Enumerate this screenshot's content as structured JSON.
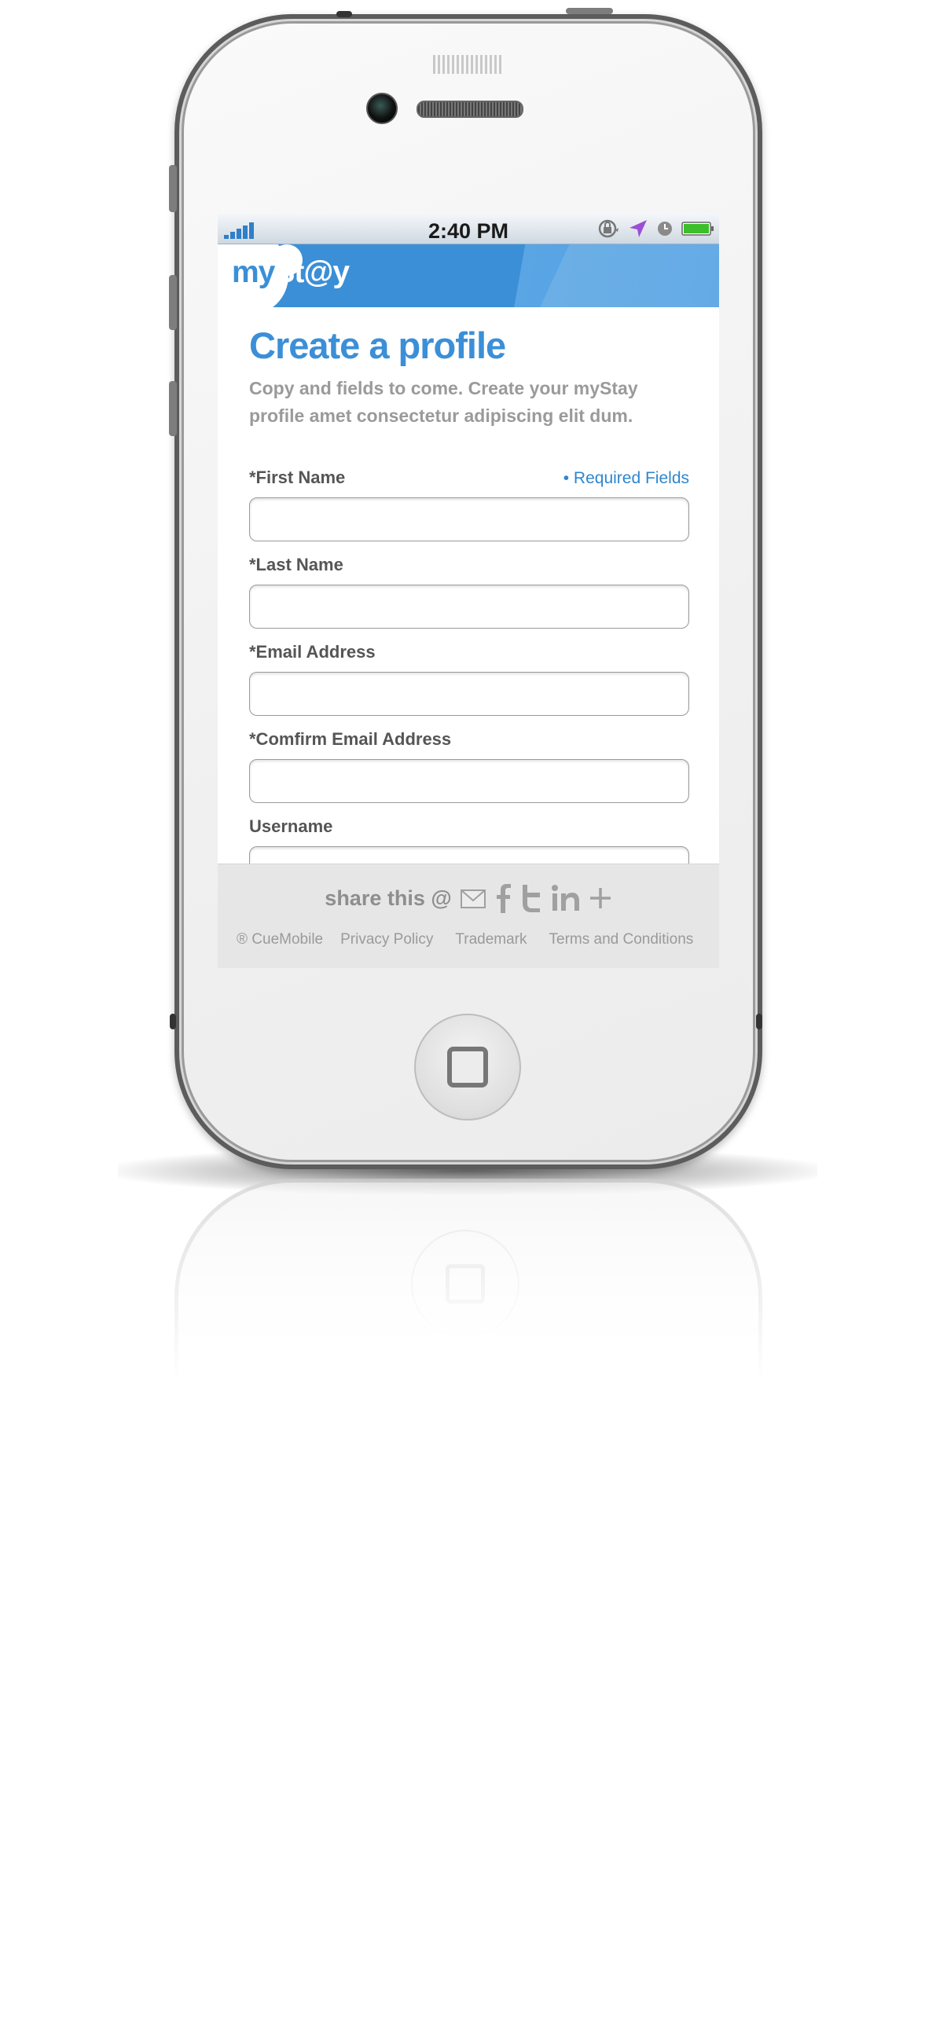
{
  "status_bar": {
    "time": "2:40 PM",
    "icons": [
      "signal-icon",
      "rotation-lock-icon",
      "location-icon",
      "alarm-icon",
      "battery-icon"
    ]
  },
  "header": {
    "logo_part1": "my",
    "logo_part2": "St@y",
    "brand_color": "#3b8fd7"
  },
  "form": {
    "title": "Create a profile",
    "subtitle": "Copy and fields to come. Create your myStay profile amet consectetur adipiscing elit dum.",
    "required_note": "• Required Fields",
    "fields": [
      {
        "label": "*First Name",
        "value": ""
      },
      {
        "label": "*Last Name",
        "value": ""
      },
      {
        "label": "*Email Address",
        "value": ""
      },
      {
        "label": "*Comfirm Email Address",
        "value": ""
      },
      {
        "label": "Username",
        "value": ""
      }
    ]
  },
  "footer": {
    "share_label": "share this @",
    "share_icons": [
      "email-icon",
      "facebook-icon",
      "twitter-icon",
      "linkedin-icon",
      "plus-icon"
    ],
    "links": {
      "copyright": "® CueMobile",
      "privacy": "Privacy Policy",
      "trademark": "Trademark",
      "terms": "Terms and Conditions"
    }
  }
}
